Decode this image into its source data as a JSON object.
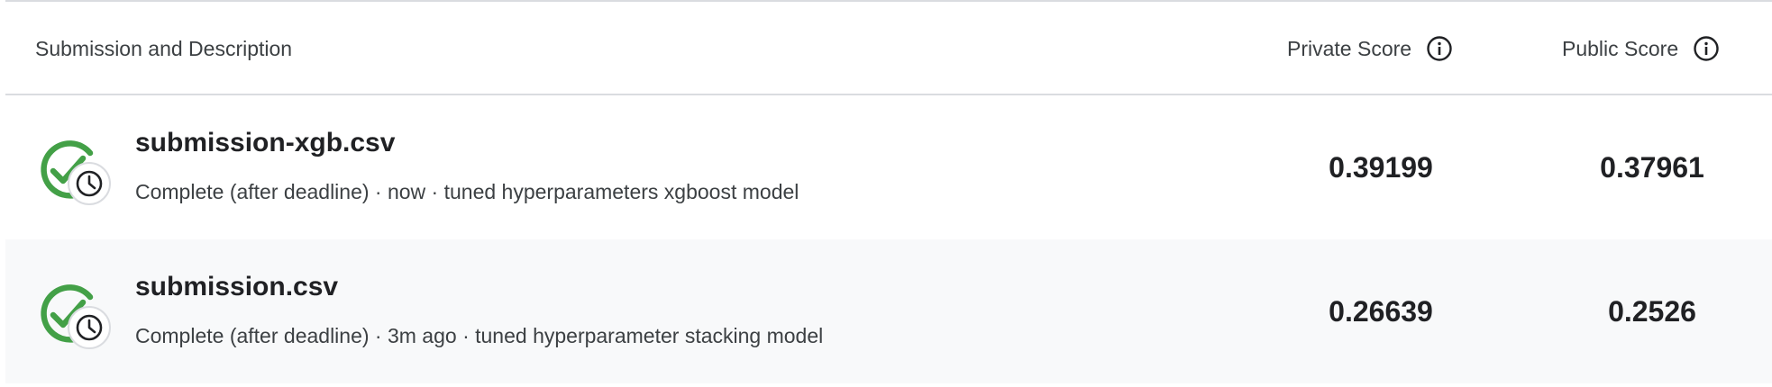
{
  "header": {
    "description_label": "Submission and Description",
    "private_label": "Private Score",
    "public_label": "Public Score"
  },
  "colors": {
    "success_green": "#43a047",
    "divider": "#dadce0",
    "alt_row_bg": "#f8f9fa"
  },
  "icons": {
    "status": "check-circle-with-clock-icon",
    "info": "info-icon"
  },
  "submissions": [
    {
      "filename": "submission-xgb.csv",
      "description": "Complete (after deadline) · now · tuned hyperparameters xgboost model",
      "private_score": "0.39199",
      "public_score": "0.37961"
    },
    {
      "filename": "submission.csv",
      "description": "Complete (after deadline) · 3m ago · tuned hyperparameter stacking model",
      "private_score": "0.26639",
      "public_score": "0.2526"
    }
  ]
}
